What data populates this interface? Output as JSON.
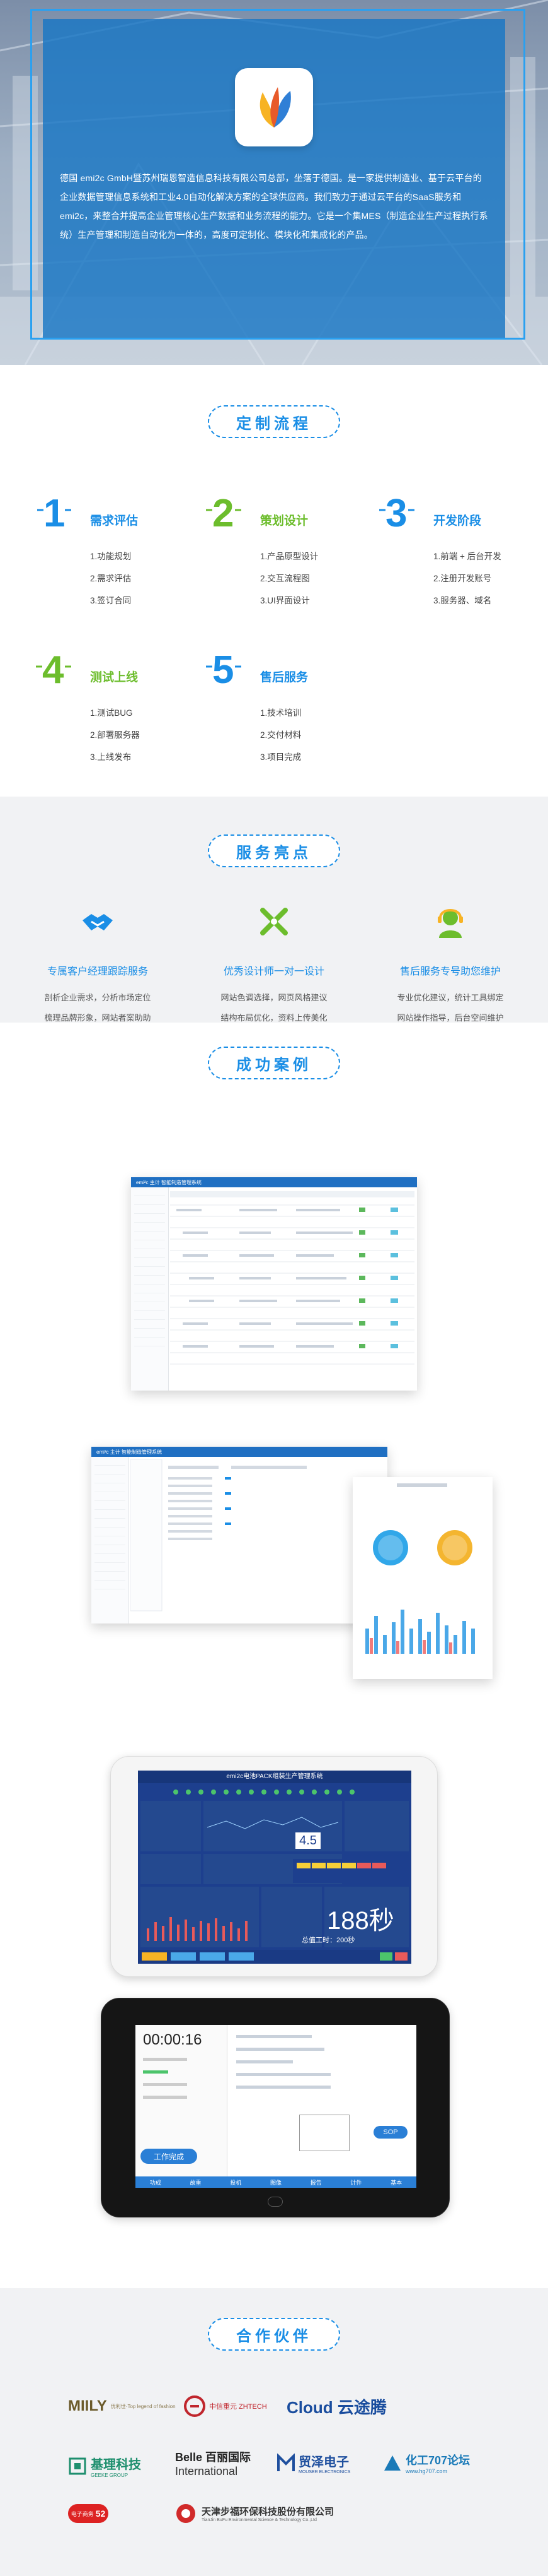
{
  "hero": {
    "intro": "德国 emi2c GmbH暨苏州瑞恩智造信息科技有限公司总部，坐落于德国。是一家提供制造业、基于云平台的企业数据管理信息系统和工业4.0自动化解决方案的全球供应商。我们致力于通过云平台的SaaS服务和emi2c，来整合并提高企业管理核心生产数据和业务流程的能力。它是一个集MES（制造企业生产过程执行系统）生产管理和制造自动化为一体的，高度可定制化、模块化和集成化的产品。",
    "logo_icon": "flame-petal-icon"
  },
  "process": {
    "title": "定制流程",
    "steps": [
      {
        "num": "1",
        "name": "需求评估",
        "items": [
          "1.功能规划",
          "2.需求评估",
          "3.签订合同"
        ],
        "color": "#1a8ee6"
      },
      {
        "num": "2",
        "name": "策划设计",
        "items": [
          "1.产品原型设计",
          "2.交互流程图",
          "3.UI界面设计"
        ],
        "color": "#6cbd2c"
      },
      {
        "num": "3",
        "name": "开发阶段",
        "items": [
          "1.前端 + 后台开发",
          "2.注册开发账号",
          "3.服务器、域名"
        ],
        "color": "#1a8ee6"
      },
      {
        "num": "4",
        "name": "测试上线",
        "items": [
          "1.测试BUG",
          "2.部署服务器",
          "3.上线发布"
        ],
        "color": "#6cbd2c"
      },
      {
        "num": "5",
        "name": "售后服务",
        "items": [
          "1.技术培训",
          "2.交付材料",
          "3.项目完成"
        ],
        "color": "#1a8ee6"
      }
    ]
  },
  "highlights": {
    "title": "服务亮点",
    "items": [
      {
        "icon": "handshake-icon",
        "name": "专属客户经理跟踪服务",
        "desc": [
          "剖析企业需求，分析市场定位",
          "梳理品牌形象，网站者案助助"
        ]
      },
      {
        "icon": "design-tools-icon",
        "name": "优秀设计师一对一设计",
        "desc": [
          "网站色调选择，网页风格建议",
          "结构布局优化，资料上传美化"
        ]
      },
      {
        "icon": "support-agent-icon",
        "name": "售后服务专号助您维护",
        "desc": [
          "专业优化建议，统计工具绑定",
          "网站操作指导，后台空间维护"
        ]
      }
    ]
  },
  "cases": {
    "title": "成功案例",
    "screen1_title": "emi²c  主计 智能制造管理系统",
    "screen2_title": "emi²c  主计 智能制造管理系统",
    "screen3_title": "emi2c电池PACK组装生产管理系统",
    "screen3_big_value": "188秒",
    "screen3_small_value": "4.5",
    "screen3_footer": "总值工时：200秒",
    "screen4_timer": "00:00:16",
    "screen4_button": "工作完成",
    "screen4_sop": "SOP",
    "screen4_tabs": [
      "功成",
      "故重",
      "投机",
      "图像",
      "报告",
      "计件",
      "基本"
    ]
  },
  "partners": {
    "title": "合作伙伴",
    "logos": [
      {
        "name": "MIILY",
        "sub": "优利世·Top legend of fashion",
        "color": "#6b5a2a"
      },
      {
        "name": "中信重元 ZHTECH",
        "color": "#c0262d"
      },
      {
        "name": "Cloud 云途腾",
        "color": "#1a4d9e"
      },
      {
        "name": "基理科技",
        "sub": "GEEKE GROUP",
        "color": "#1e8f6e"
      },
      {
        "name": "Belle 百丽国际",
        "sub": "International",
        "color": "#222"
      },
      {
        "name": "贸泽电子",
        "sub": "MOUSER ELECTRONICS",
        "color": "#1e4f9e"
      },
      {
        "name": "化工707论坛",
        "sub": "www.hg707.com",
        "color": "#1a7ab8"
      },
      {
        "name": "52",
        "sub": "电子商务",
        "color": "#d22"
      },
      {
        "name": "天津步福环保科技股份有限公司",
        "sub": "TianJin BuFu Environmental Science & Technology Co.,Ltd",
        "color": "#333"
      }
    ]
  }
}
